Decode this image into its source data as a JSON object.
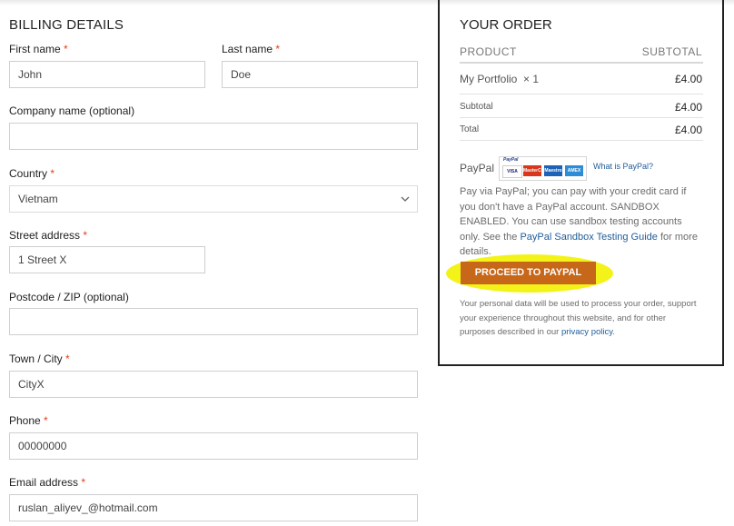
{
  "billing": {
    "title": "BILLING DETAILS",
    "first_name": {
      "label": "First name",
      "value": "John"
    },
    "last_name": {
      "label": "Last name",
      "value": "Doe"
    },
    "company": {
      "label": "Company name (optional)",
      "value": ""
    },
    "country": {
      "label": "Country",
      "value": "Vietnam"
    },
    "street": {
      "label": "Street address",
      "value": "1 Street X"
    },
    "postcode": {
      "label": "Postcode / ZIP (optional)",
      "value": ""
    },
    "city": {
      "label": "Town / City",
      "value": "CityX"
    },
    "phone": {
      "label": "Phone",
      "value": "00000000"
    },
    "email": {
      "label": "Email address",
      "value": "ruslan_aliyev_@hotmail.com"
    },
    "required_mark": "*"
  },
  "order": {
    "title": "YOUR ORDER",
    "col_product": "PRODUCT",
    "col_subtotal": "SUBTOTAL",
    "item_name": "My Portfolio",
    "item_qty": "× 1",
    "item_total": "£4.00",
    "subtotal_label": "Subtotal",
    "subtotal_value": "£4.00",
    "total_label": "Total",
    "total_value": "£4.00",
    "payment_method": "PayPal",
    "paypal_logo_text": "PayPal",
    "card_labels": [
      "VISA",
      "MasterCard",
      "Maestro",
      "AMEX"
    ],
    "what_is_paypal": "What is PayPal?",
    "description_before": "Pay via PayPal; you can pay with your credit card if you don't have a PayPal account. SANDBOX ENABLED. You can use sandbox testing accounts only. See the ",
    "description_link": "PayPal Sandbox Testing Guide",
    "description_after": " for more details.",
    "proceed_button": "PROCEED TO PAYPAL",
    "privacy_before": "Your personal data will be used to process your order, support your experience throughout this website, and for other purposes described in our ",
    "privacy_link": "privacy policy",
    "privacy_after": ".",
    "highlight_color": "#f3f31a",
    "button_color": "#c7671a"
  }
}
